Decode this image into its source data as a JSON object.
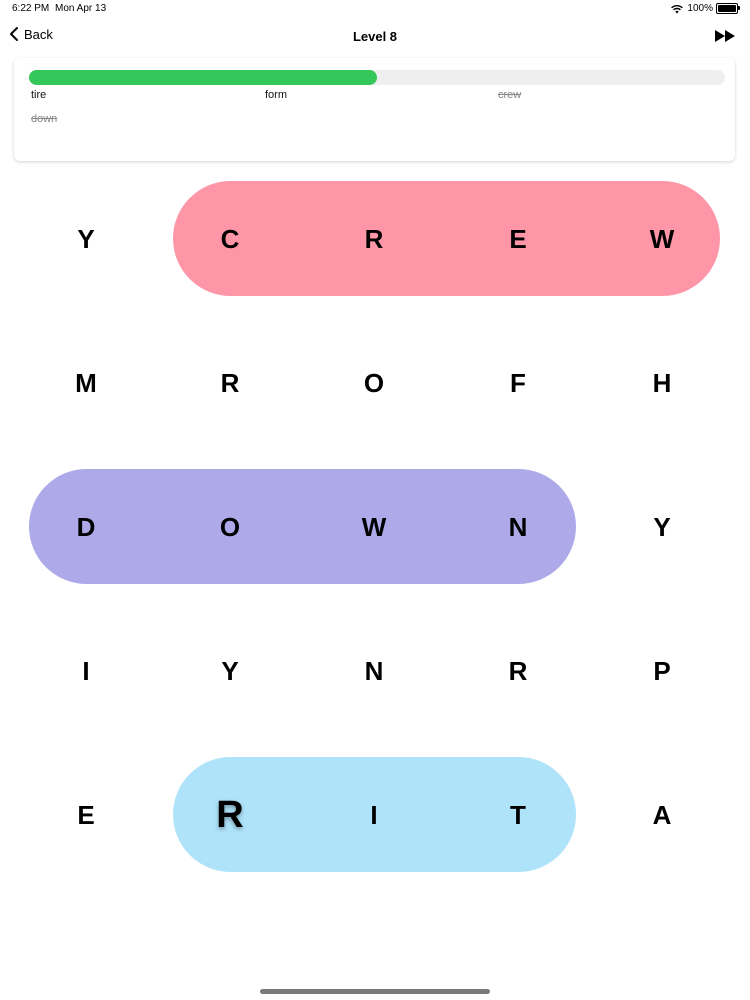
{
  "status_bar": {
    "time": "6:22 PM",
    "date": "Mon Apr 13",
    "battery": "100%"
  },
  "nav": {
    "back_label": "Back",
    "title": "Level 8"
  },
  "progress": {
    "fraction": 0.5
  },
  "words": [
    {
      "text": "tire",
      "found": false
    },
    {
      "text": "form",
      "found": false
    },
    {
      "text": "crew",
      "found": true
    },
    {
      "text": "down",
      "found": true
    }
  ],
  "grid": [
    [
      "Y",
      "C",
      "R",
      "E",
      "W"
    ],
    [
      "M",
      "R",
      "O",
      "F",
      "H"
    ],
    [
      "D",
      "O",
      "W",
      "N",
      "Y"
    ],
    [
      "I",
      "Y",
      "N",
      "R",
      "P"
    ],
    [
      "E",
      "R",
      "I",
      "T",
      "A"
    ]
  ],
  "colors": {
    "progress": "#34c759",
    "crew_highlight": "#ff96a8",
    "down_highlight": "#aeaae9",
    "selection_highlight": "#aee3f9"
  }
}
